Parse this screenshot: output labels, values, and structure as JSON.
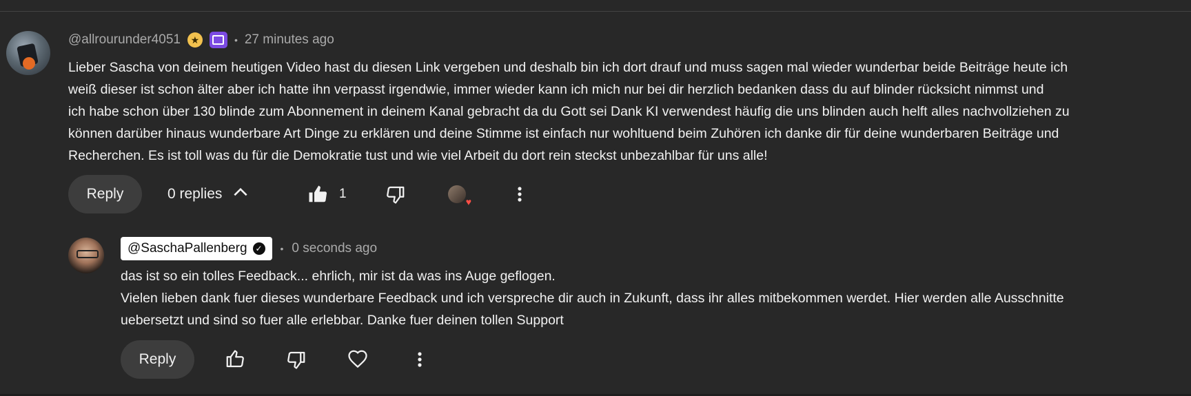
{
  "comment": {
    "author": "@allrourunder4051",
    "time": "27 minutes ago",
    "lines": [
      "Lieber Sascha von deinem heutigen Video hast du diesen Link vergeben und deshalb bin ich dort drauf und muss sagen mal wieder wunderbar beide Beiträge heute ich",
      "weiß dieser ist schon älter aber ich hatte ihn verpasst irgendwie, immer wieder kann ich mich nur bei dir herzlich bedanken dass du auf blinder rücksicht nimmst und",
      "ich habe schon über 130 blinde zum Abonnement in deinem Kanal gebracht da du Gott sei Dank KI verwendest häufig die uns blinden auch helft alles nachvollziehen zu",
      "können darüber hinaus wunderbare Art Dinge zu erklären und deine Stimme ist einfach nur wohltuend beim Zuhören ich danke dir für deine wunderbaren Beiträge und",
      "Recherchen. Es ist toll was du für die Demokratie tust und wie viel Arbeit du dort rein steckst unbezahlbar für uns alle!"
    ],
    "actions": {
      "reply_label": "Reply",
      "replies_label": "0 replies",
      "like_count": "1"
    },
    "icons": {
      "star_badge": "star-icon",
      "member_badge": "chat-badge-icon",
      "like": "thumb-up-filled-icon",
      "dislike": "thumb-down-icon",
      "creator_heart": "heart-icon",
      "more": "more-vert-icon",
      "collapse": "chevron-up-icon"
    }
  },
  "reply": {
    "author": "@SaschaPallenberg",
    "time": "0 seconds ago",
    "lines": [
      "das ist so ein tolles Feedback... ehrlich, mir ist da was ins Auge geflogen.",
      "Vielen lieben dank fuer dieses wunderbare Feedback und ich verspreche dir auch in Zukunft, dass ihr alles mitbekommen werdet. Hier werden alle Ausschnitte",
      "uebersetzt und sind so fuer alle erlebbar. Danke fuer deinen tollen Support"
    ],
    "actions": {
      "reply_label": "Reply"
    }
  },
  "colors": {
    "background": "#282828",
    "text": "#f1f1f1",
    "muted": "#aaaaaa",
    "button": "#3d3d3d",
    "member_badge": "#7b4ae2",
    "star_badge": "#f2c14e",
    "heart": "#ff4e45"
  }
}
